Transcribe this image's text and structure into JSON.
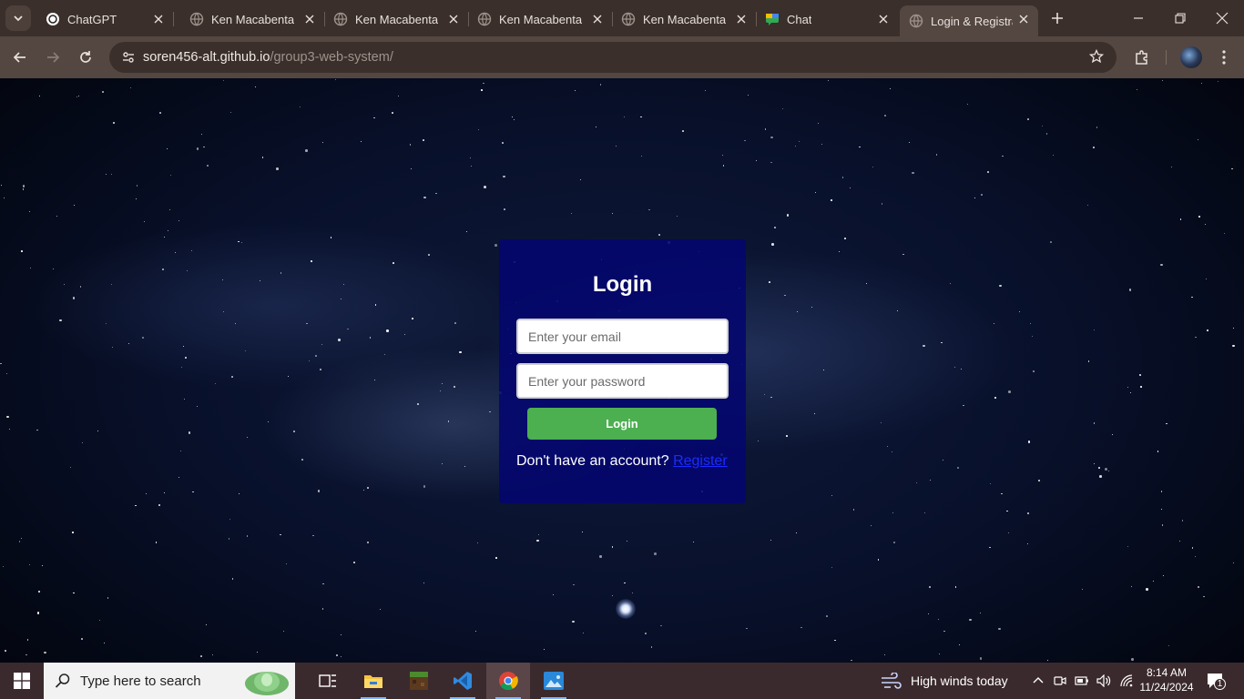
{
  "browser": {
    "tabs": [
      {
        "label": "ChatGPT",
        "icon": "chatgpt-icon"
      },
      {
        "label": "Ken Macabenta",
        "icon": "globe-icon"
      },
      {
        "label": "Ken Macabenta",
        "icon": "globe-icon"
      },
      {
        "label": "Ken Macabenta",
        "icon": "globe-icon"
      },
      {
        "label": "Ken Macabenta",
        "icon": "globe-icon"
      },
      {
        "label": "Chat",
        "icon": "chat-icon"
      },
      {
        "label": "Login & Registra",
        "icon": "globe-icon",
        "active": true
      }
    ],
    "url_host": "soren456-alt.github.io",
    "url_path": "/group3-web-system/",
    "accent": "#544741"
  },
  "login": {
    "title": "Login",
    "email_placeholder": "Enter your email",
    "password_placeholder": "Enter your password",
    "button_label": "Login",
    "register_prompt": "Don't have an account?",
    "register_link": "Register",
    "button_color": "#4caf50",
    "card_color": "#03066e"
  },
  "taskbar": {
    "search_placeholder": "Type here to search",
    "weather": "High winds today",
    "time": "8:14 AM",
    "date": "11/24/2024",
    "notifications": "1"
  }
}
